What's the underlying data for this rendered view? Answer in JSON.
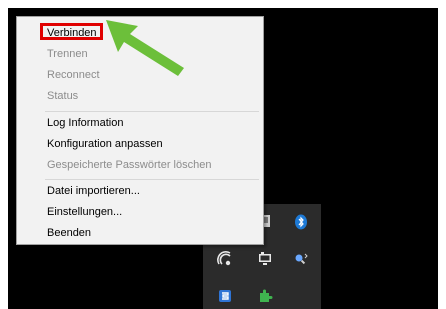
{
  "menu": {
    "items": [
      {
        "label": "Verbinden",
        "enabled": true
      },
      {
        "label": "Trennen",
        "enabled": false
      },
      {
        "label": "Reconnect",
        "enabled": false
      },
      {
        "label": "Status",
        "enabled": false
      },
      {
        "label": "Log Information",
        "enabled": true
      },
      {
        "label": "Konfiguration anpassen",
        "enabled": true
      },
      {
        "label": "Gespeicherte Passwörter löschen",
        "enabled": false
      },
      {
        "label": "Datei importieren...",
        "enabled": true
      },
      {
        "label": "Einstellungen...",
        "enabled": true
      },
      {
        "label": "Beenden",
        "enabled": true
      }
    ]
  },
  "tray": {
    "icons": [
      "bluetooth-icon",
      "wireless-display-icon",
      "network-computer-icon",
      "magnifier-icon",
      "shield-icon",
      "puzzle-icon",
      "openvpn-icon"
    ]
  },
  "colors": {
    "highlight": "#e00000",
    "arrow": "#6cbf3a",
    "disabled_text": "#8c8c8c",
    "menu_background": "#f2f2f2"
  }
}
